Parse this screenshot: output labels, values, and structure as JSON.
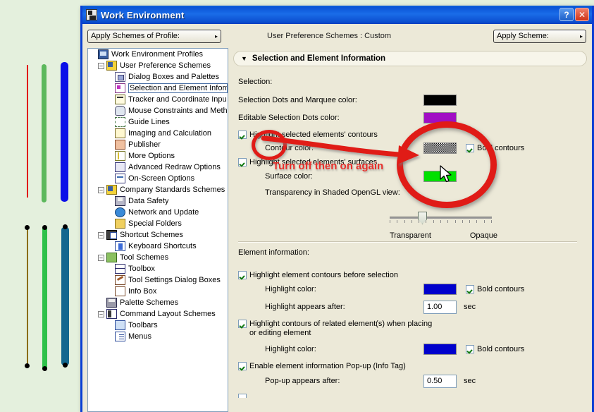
{
  "window": {
    "title": "Work Environment",
    "icon": "app-window-icon",
    "help_button": "?",
    "close_button": "✕",
    "border_color": "#0a3fd4"
  },
  "toolbar": {
    "profile_combo_label": "Apply Schemes of Profile:",
    "scheme_status": "User Preference Schemes : Custom",
    "scheme_combo_label": "Apply Scheme:",
    "dropdown_arrow": "▸"
  },
  "tree": {
    "nodes": [
      {
        "label": "Work Environment Profiles",
        "depth": 0,
        "expander": "",
        "icon": "ic-mon",
        "selected": false
      },
      {
        "label": "User Preference Schemes",
        "depth": 1,
        "expander": "–",
        "icon": "ic-sch",
        "selected": false
      },
      {
        "label": "Dialog Boxes and Palettes",
        "depth": 2,
        "expander": "",
        "icon": "ic-win",
        "selected": false
      },
      {
        "label": "Selection and Element Inform",
        "depth": 2,
        "expander": "",
        "icon": "ic-sel",
        "selected": true
      },
      {
        "label": "Tracker and Coordinate Inpu",
        "depth": 2,
        "expander": "",
        "icon": "ic-trk",
        "selected": false
      },
      {
        "label": "Mouse Constraints and Meth",
        "depth": 2,
        "expander": "",
        "icon": "ic-mou",
        "selected": false
      },
      {
        "label": "Guide Lines",
        "depth": 2,
        "expander": "",
        "icon": "ic-gui",
        "selected": false
      },
      {
        "label": "Imaging and Calculation",
        "depth": 2,
        "expander": "",
        "icon": "ic-img",
        "selected": false
      },
      {
        "label": "Publisher",
        "depth": 2,
        "expander": "",
        "icon": "ic-pub",
        "selected": false
      },
      {
        "label": "More Options",
        "depth": 2,
        "expander": "",
        "icon": "ic-mor",
        "selected": false
      },
      {
        "label": "Advanced Redraw Options",
        "depth": 2,
        "expander": "",
        "icon": "ic-adv",
        "selected": false
      },
      {
        "label": "On-Screen Options",
        "depth": 2,
        "expander": "",
        "icon": "ic-osc",
        "selected": false
      },
      {
        "label": "Company Standards Schemes",
        "depth": 1,
        "expander": "–",
        "icon": "ic-sch",
        "selected": false
      },
      {
        "label": "Data Safety",
        "depth": 2,
        "expander": "",
        "icon": "ic-dsk",
        "selected": false
      },
      {
        "label": "Network and Update",
        "depth": 2,
        "expander": "",
        "icon": "ic-net",
        "selected": false
      },
      {
        "label": "Special Folders",
        "depth": 2,
        "expander": "",
        "icon": "ic-fld",
        "selected": false
      },
      {
        "label": "Shortcut Schemes",
        "depth": 1,
        "expander": "–",
        "icon": "ic-sc",
        "selected": false
      },
      {
        "label": "Keyboard Shortcuts",
        "depth": 2,
        "expander": "",
        "icon": "ic-key",
        "selected": false
      },
      {
        "label": "Tool Schemes",
        "depth": 1,
        "expander": "–",
        "icon": "ic-tool",
        "selected": false
      },
      {
        "label": "Toolbox",
        "depth": 2,
        "expander": "",
        "icon": "ic-tbx",
        "selected": false
      },
      {
        "label": "Tool Settings Dialog Boxes",
        "depth": 2,
        "expander": "",
        "icon": "ic-tsd",
        "selected": false
      },
      {
        "label": "Info Box",
        "depth": 2,
        "expander": "",
        "icon": "ic-ibx",
        "selected": false
      },
      {
        "label": "Palette Schemes",
        "depth": 1,
        "expander": "",
        "icon": "ic-pal",
        "selected": false
      },
      {
        "label": "Command Layout Schemes",
        "depth": 1,
        "expander": "–",
        "icon": "ic-cmd",
        "selected": false
      },
      {
        "label": "Toolbars",
        "depth": 2,
        "expander": "",
        "icon": "ic-tbr",
        "selected": false
      },
      {
        "label": "Menus",
        "depth": 2,
        "expander": "",
        "icon": "ic-mnu",
        "selected": false
      }
    ]
  },
  "panel": {
    "group_title": "Selection and Element Information",
    "group_triangle": "▼",
    "selection_heading": "Selection:",
    "selection_dots_label": "Selection Dots and Marquee color:",
    "selection_dots_color": "#000000",
    "editable_dots_label": "Editable Selection Dots color:",
    "editable_dots_color": "#a10ec4",
    "highlight_contours_label": "Highlight selected elements' contours",
    "highlight_contours_checked": true,
    "contour_color_label": "Contour color:",
    "contour_color_value": "dither-checkerboard",
    "contour_bold_label": "Bold contours",
    "contour_bold_checked": true,
    "highlight_surfaces_label": "Highlight selected elements' surfaces",
    "highlight_surfaces_checked": true,
    "surface_color_label": "Surface color:",
    "surface_color_value": "#00e000",
    "transparency_label": "Transparency in Shaded OpenGL view:",
    "transparency_min_label": "Transparent",
    "transparency_max_label": "Opaque",
    "transparency_value_pct": 30,
    "element_info_heading": "Element information:",
    "highlight_before_label": "Highlight element contours before selection",
    "highlight_before_checked": true,
    "highlight_color_label": "Highlight color:",
    "highlight_color_value": "#0000cc",
    "highlight_bold_label": "Bold contours",
    "highlight_bold_checked": true,
    "highlight_after_label": "Highlight appears after:",
    "highlight_after_value": "1.00",
    "highlight_after_unit": "sec",
    "related_label_line1": "Highlight contours of related element(s) when placing",
    "related_label_line2": "or editing element",
    "related_checked": true,
    "related_color_label": "Highlight color:",
    "related_color_value": "#0000cc",
    "related_bold_label": "Bold contours",
    "related_bold_checked": true,
    "popup_label": "Enable element information Pop-up (Info Tag)",
    "popup_checked": true,
    "popup_after_label": "Pop-up appears after:",
    "popup_after_value": "0.50",
    "popup_after_unit": "sec"
  },
  "annotations": {
    "instruction_text": "Turn off then on again",
    "marker_color": "#e01b17",
    "text_color": "#e8302c",
    "small_oval_target": "highlight-contours-checkbox",
    "large_oval_target": "contour-color-swatch",
    "arrow": "points-right-to-contour-color"
  },
  "canvas": {
    "background_color": "#e4f0dd",
    "lines_upper": [
      {
        "color": "#e01b17",
        "width": 2
      },
      {
        "color": "#5cb85c",
        "width": 7
      },
      {
        "color": "#0b10e8",
        "width": 10
      }
    ],
    "lines_lower": [
      {
        "color": "#8a6d0b",
        "width": 2,
        "selected": true
      },
      {
        "color": "#2fc14a",
        "width": 7,
        "selected": true
      },
      {
        "color": "#14688f",
        "width": 10,
        "selected": true
      }
    ]
  }
}
